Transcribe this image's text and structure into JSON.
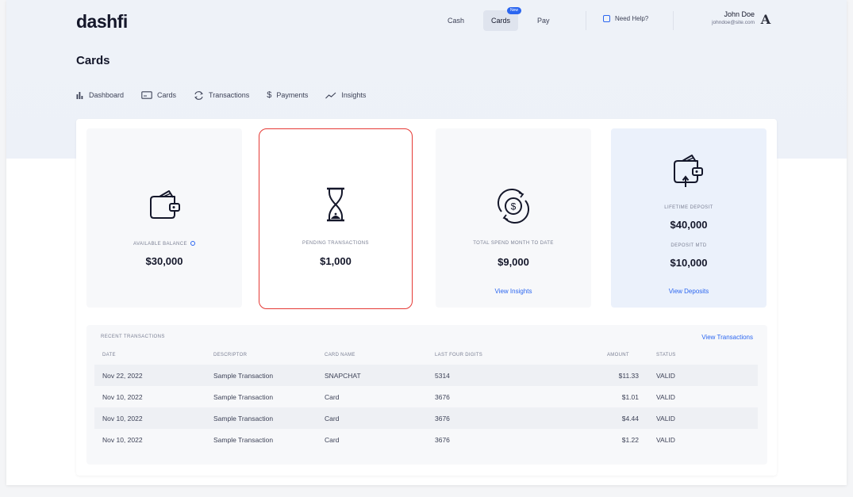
{
  "header": {
    "logo": "dashfi",
    "nav": [
      {
        "label": "Cash"
      },
      {
        "label": "Cards",
        "badge": "New",
        "active": true
      },
      {
        "label": "Pay"
      }
    ],
    "help": "Need Help?",
    "user": {
      "name": "John Doe",
      "email": "johndoe@site.com",
      "avatar": "A"
    }
  },
  "page": {
    "title": "Cards"
  },
  "subnav": [
    {
      "label": "Dashboard",
      "icon": "bar-chart-icon"
    },
    {
      "label": "Cards",
      "icon": "card-icon"
    },
    {
      "label": "Transactions",
      "icon": "exchange-icon"
    },
    {
      "label": "Payments",
      "icon": "dollar-icon"
    },
    {
      "label": "Insights",
      "icon": "trend-icon"
    }
  ],
  "cards": {
    "available": {
      "label": "AVAILABLE BALANCE",
      "value": "$30,000",
      "icon": "wallet-icon"
    },
    "pending": {
      "label": "PENDING TRANSACTIONS",
      "value": "$1,000",
      "icon": "hourglass-icon"
    },
    "spend": {
      "label": "TOTAL SPEND MONTH TO DATE",
      "value": "$9,000",
      "link": "View Insights",
      "icon": "dollar-cycle-icon"
    },
    "deposit": {
      "label1": "LIFETIME DEPOSIT",
      "value1": "$40,000",
      "label2": "DEPOSIT MTD",
      "value2": "$10,000",
      "link": "View Deposits",
      "icon": "wallet-deposit-icon"
    }
  },
  "transactions": {
    "title": "RECENT TRANSACTIONS",
    "link": "View Transactions",
    "headers": {
      "date": "DATE",
      "descriptor": "DESCRIPTOR",
      "card": "CARD NAME",
      "digits": "LAST FOUR DIGITS",
      "amount": "AMOUNT",
      "status": "STATUS"
    },
    "rows": [
      {
        "date": "Nov 22, 2022",
        "descriptor": "Sample Transaction",
        "card": "SNAPCHAT",
        "digits": "5314",
        "amount": "$11.33",
        "status": "VALID"
      },
      {
        "date": "Nov 10, 2022",
        "descriptor": "Sample Transaction",
        "card": "Card",
        "digits": "3676",
        "amount": "$1.01",
        "status": "VALID"
      },
      {
        "date": "Nov 10, 2022",
        "descriptor": "Sample Transaction",
        "card": "Card",
        "digits": "3676",
        "amount": "$4.44",
        "status": "VALID"
      },
      {
        "date": "Nov 10, 2022",
        "descriptor": "Sample Transaction",
        "card": "Card",
        "digits": "3676",
        "amount": "$1.22",
        "status": "VALID"
      }
    ]
  },
  "colors": {
    "accent": "#2b66f0",
    "highlight_border": "#e53935",
    "deposit_bg": "#ebf1fb"
  }
}
